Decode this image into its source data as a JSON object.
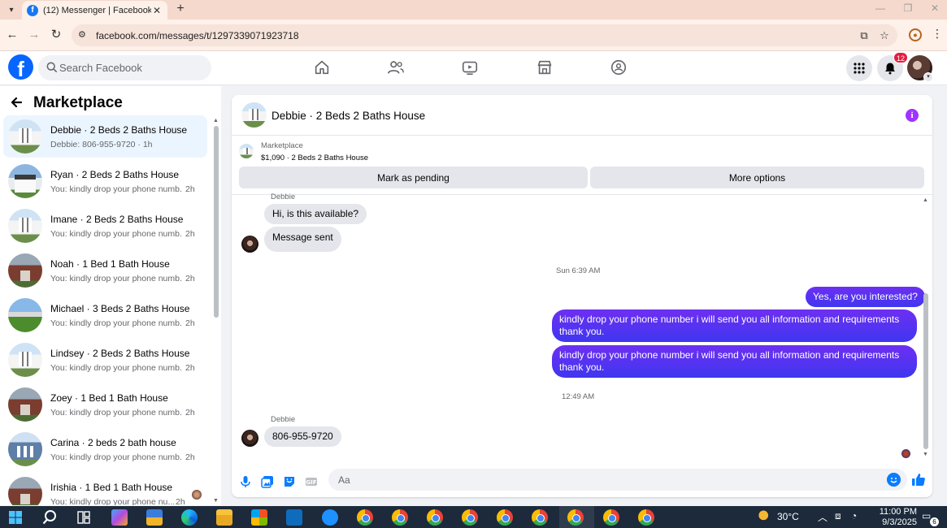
{
  "browser": {
    "tab_title": "(12) Messenger | Facebook",
    "tab_favicon": "f",
    "url": "facebook.com/messages/t/1297339071923718"
  },
  "header": {
    "logo_letter": "f",
    "search_placeholder": "Search Facebook",
    "notification_count": "12",
    "brand_color": "#0866ff"
  },
  "sidebar": {
    "title": "Marketplace",
    "conversations": [
      {
        "name": "Debbie · 2 Beds 2 Baths House",
        "snippet": "Debbie: 806-955-9720 · 1h",
        "time": "",
        "thumb": "house-white"
      },
      {
        "name": "Ryan · 2 Beds 2 Baths House",
        "snippet": "You: kindly drop your phone numb...",
        "time": "2h",
        "thumb": "house-small"
      },
      {
        "name": "Imane · 2 Beds 2 Baths House",
        "snippet": "You: kindly drop your phone numb...",
        "time": "2h",
        "thumb": "house-white"
      },
      {
        "name": "Noah · 1 Bed 1 Bath House",
        "snippet": "You: kindly drop your phone numb...",
        "time": "2h",
        "thumb": "house-brick"
      },
      {
        "name": "Michael · 3 Beds 2 Baths House",
        "snippet": "You: kindly drop your phone numb...",
        "time": "2h",
        "thumb": "house-green"
      },
      {
        "name": "Lindsey · 2 Beds 2 Baths House",
        "snippet": "You: kindly drop your phone numb...",
        "time": "2h",
        "thumb": "house-white"
      },
      {
        "name": "Zoey · 1 Bed 1 Bath House",
        "snippet": "You: kindly drop your phone numb...",
        "time": "2h",
        "thumb": "house-brick"
      },
      {
        "name": "Carina · 2 beds 2 bath house",
        "snippet": "You: kindly drop your phone numb...",
        "time": "2h",
        "thumb": "house-blue"
      },
      {
        "name": "Irishia · 1 Bed 1 Bath House",
        "snippet": "You: kindly drop your phone nu...",
        "time": "2h",
        "thumb": "house-brick"
      }
    ]
  },
  "chat": {
    "title": "Debbie · 2 Beds 2 Baths House",
    "marketplace_label": "Marketplace",
    "listing": "$1,090 · 2 Beds 2 Baths House",
    "mark_pending_label": "Mark as pending",
    "more_options_label": "More options",
    "sender_top": "Debbie",
    "incoming_1": "Hi, is this available?",
    "incoming_2": "Message sent",
    "stamp_1": "Sun 6:39 AM",
    "outgoing_1": "Yes, are you interested?",
    "outgoing_2": "kindly drop your phone number i will send you all information and requirements thank you.",
    "outgoing_3": "kindly drop your phone number i will send you all information and requirements thank you.",
    "stamp_2": "12:49 AM",
    "sender_bottom": "Debbie",
    "incoming_3": "806-955-9720",
    "composer_placeholder": "Aa",
    "accent_color": "#4f2ef0"
  },
  "taskbar": {
    "temperature": "30°C",
    "time": "11:00 PM",
    "date": "9/3/2025",
    "notification_count": "6"
  }
}
